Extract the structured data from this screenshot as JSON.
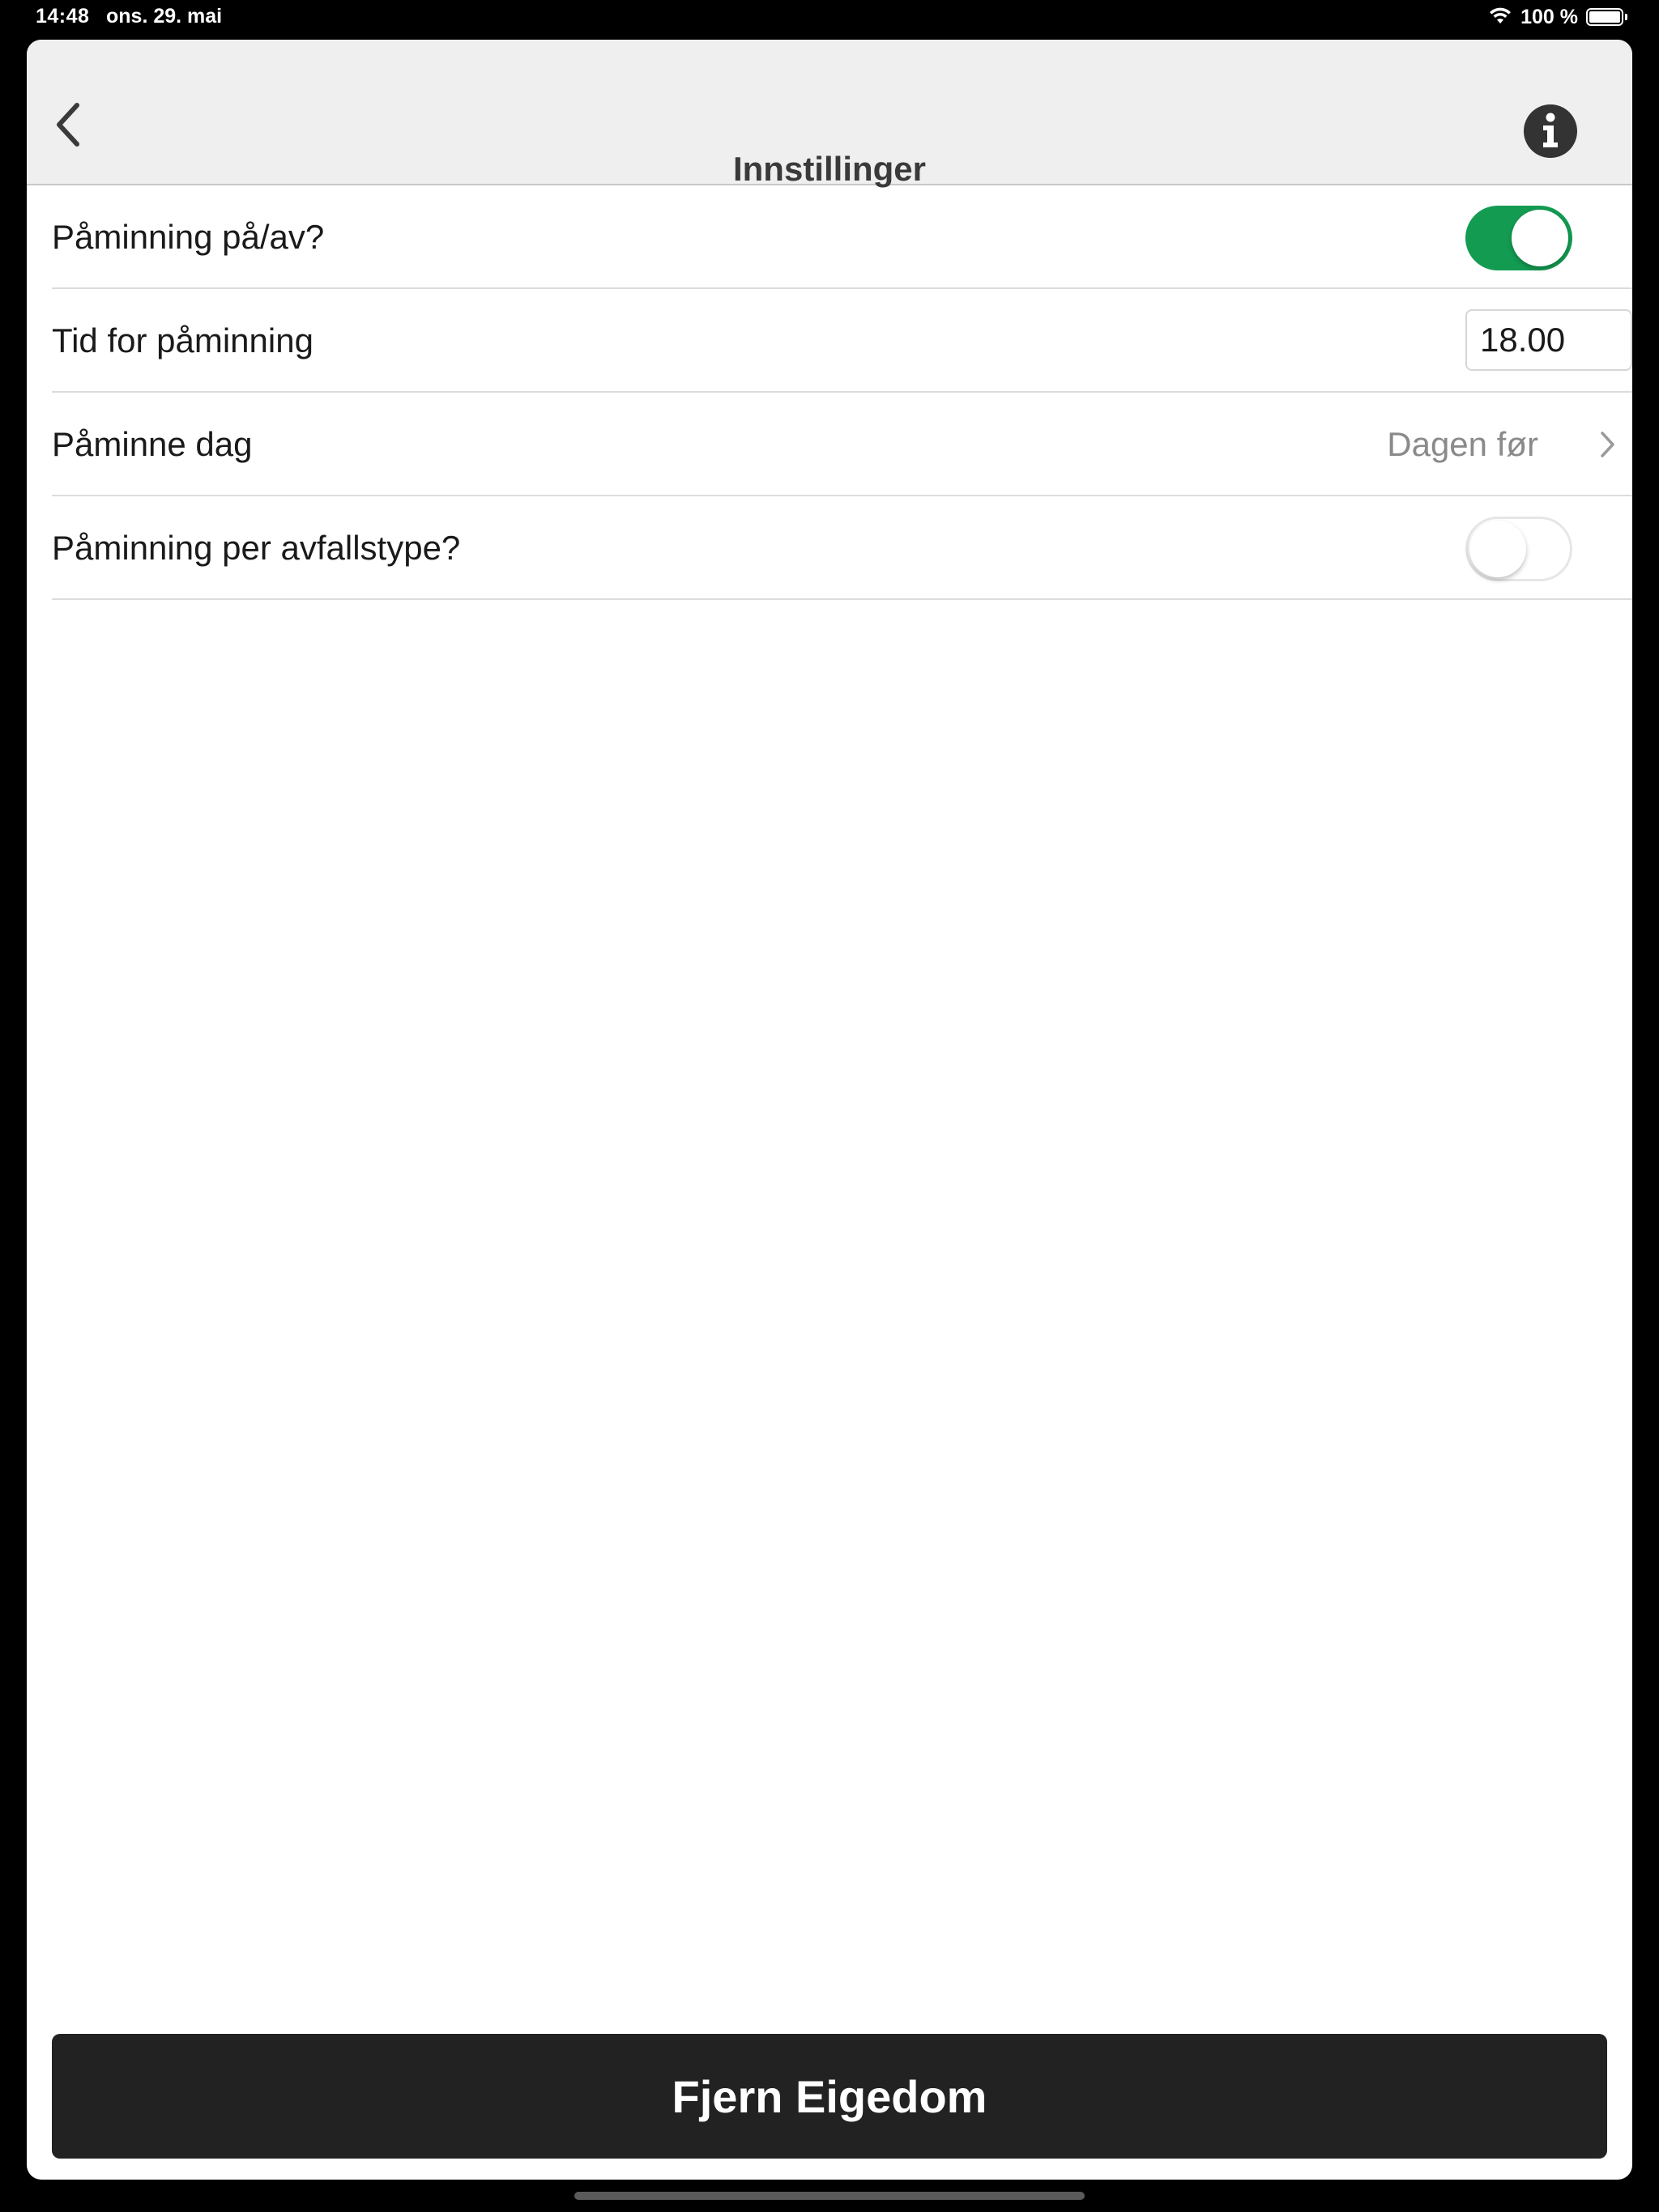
{
  "status_bar": {
    "time": "14:48",
    "date": "ons. 29. mai",
    "battery_percent": "100 %",
    "battery_level": 1.0
  },
  "nav": {
    "title": "Innstillinger",
    "back_icon": "chevron-left-icon",
    "info_icon": "info-circle-icon"
  },
  "settings": {
    "reminder_toggle": {
      "label": "Påminning på/av?",
      "on": true,
      "on_color": "#139b52"
    },
    "reminder_time": {
      "label": "Tid for påminning",
      "value": "18.00"
    },
    "reminder_day": {
      "label": "Påminne dag",
      "value": "Dagen før"
    },
    "per_waste_type": {
      "label": "Påminning per avfallstype?",
      "on": false
    }
  },
  "actions": {
    "remove_property_label": "Fjern Eigedom"
  }
}
